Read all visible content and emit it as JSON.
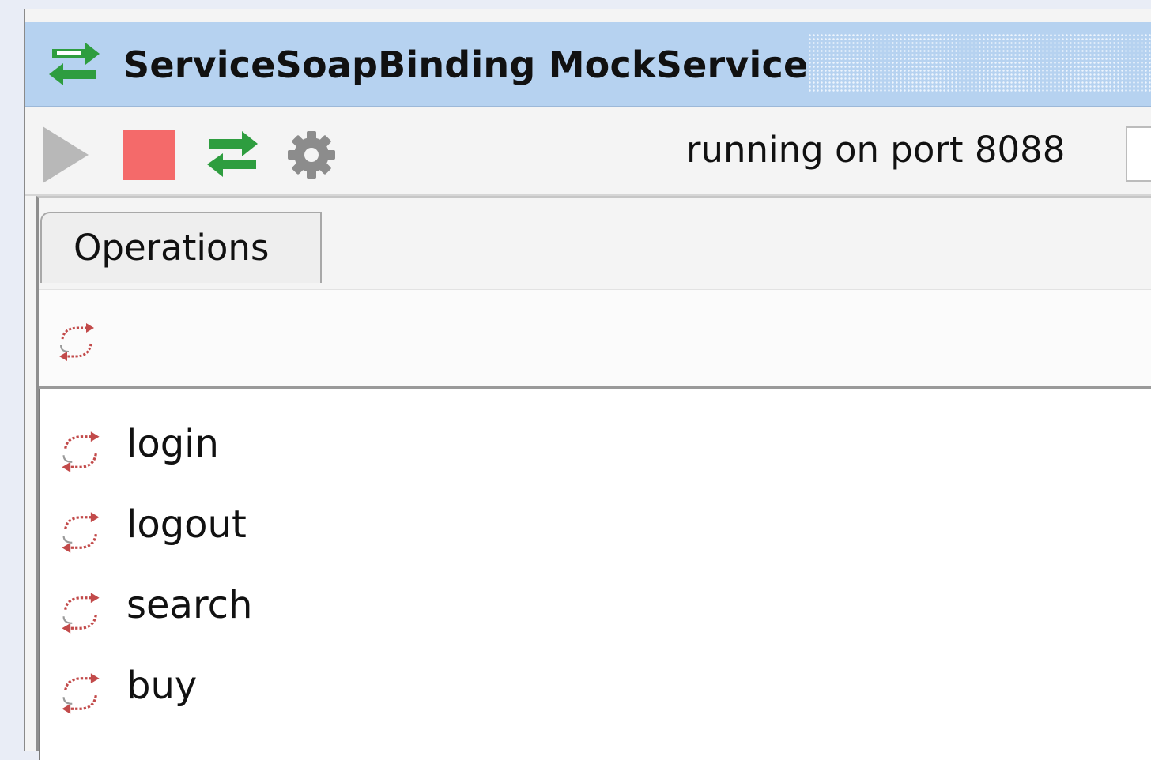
{
  "window": {
    "title": "ServiceSoapBinding MockService",
    "title_icon": "mockservice-arrows-icon"
  },
  "toolbar": {
    "buttons": [
      {
        "name": "start-button",
        "icon": "play-icon",
        "state": "disabled"
      },
      {
        "name": "stop-button",
        "icon": "stop-icon",
        "state": "enabled"
      },
      {
        "name": "open-service-button",
        "icon": "mockservice-arrows-icon",
        "state": "enabled"
      },
      {
        "name": "options-button",
        "icon": "gear-icon",
        "state": "enabled"
      }
    ],
    "status": "running on port 8088"
  },
  "tabs": [
    {
      "label": "Operations",
      "selected": true
    }
  ],
  "operations": {
    "toolbar_icon": "mock-operation-icon",
    "items": [
      {
        "label": "login",
        "icon": "mock-operation-icon"
      },
      {
        "label": "logout",
        "icon": "mock-operation-icon"
      },
      {
        "label": "search",
        "icon": "mock-operation-icon"
      },
      {
        "label": "buy",
        "icon": "mock-operation-icon"
      }
    ]
  },
  "colors": {
    "title_bar": "#b6d2f0",
    "stop_red": "#f46a6a",
    "play_gray": "#b8b8b8",
    "arrows_green": "#2e9d3f",
    "operation_icon_red": "#c24a4a"
  }
}
